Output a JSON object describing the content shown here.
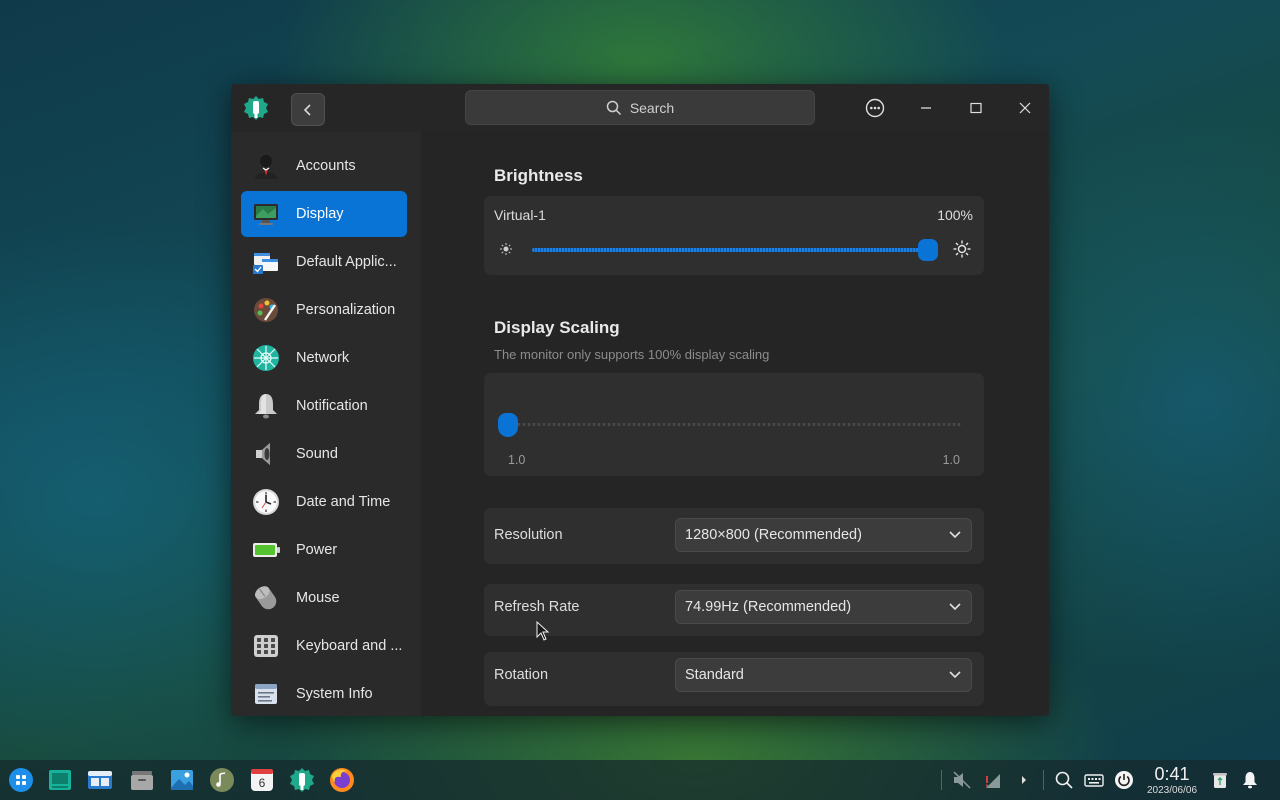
{
  "window": {
    "search_placeholder": "Search"
  },
  "sidebar": {
    "items": [
      {
        "label": "Accounts",
        "icon": "accounts-icon"
      },
      {
        "label": "Display",
        "icon": "display-icon",
        "active": true
      },
      {
        "label": "Default Applic...",
        "icon": "default-apps-icon"
      },
      {
        "label": "Personalization",
        "icon": "personalization-icon"
      },
      {
        "label": "Network",
        "icon": "network-icon"
      },
      {
        "label": "Notification",
        "icon": "notification-icon"
      },
      {
        "label": "Sound",
        "icon": "sound-icon"
      },
      {
        "label": "Date and Time",
        "icon": "clock-icon"
      },
      {
        "label": "Power",
        "icon": "battery-icon"
      },
      {
        "label": "Mouse",
        "icon": "mouse-icon"
      },
      {
        "label": "Keyboard and ...",
        "icon": "keyboard-icon"
      },
      {
        "label": "System Info",
        "icon": "system-info-icon"
      }
    ]
  },
  "brightness": {
    "title": "Brightness",
    "monitor": "Virtual-1",
    "value_label": "100%",
    "value_fraction": 1.0
  },
  "scaling": {
    "title": "Display Scaling",
    "note": "The monitor only supports 100% display scaling",
    "min_label": "1.0",
    "max_label": "1.0",
    "value_fraction": 0.0
  },
  "resolution": {
    "label": "Resolution",
    "value": "1280×800 (Recommended)"
  },
  "refresh": {
    "label": "Refresh Rate",
    "value": "74.99Hz (Recommended)"
  },
  "rotation": {
    "label": "Rotation",
    "value": "Standard"
  },
  "clock": {
    "time": "0:41",
    "date": "2023/06/06"
  },
  "calendar_icon_day": "6",
  "colors": {
    "accent": "#0a74d6",
    "window_bg": "#2a2a2a",
    "content_bg": "#252525"
  }
}
